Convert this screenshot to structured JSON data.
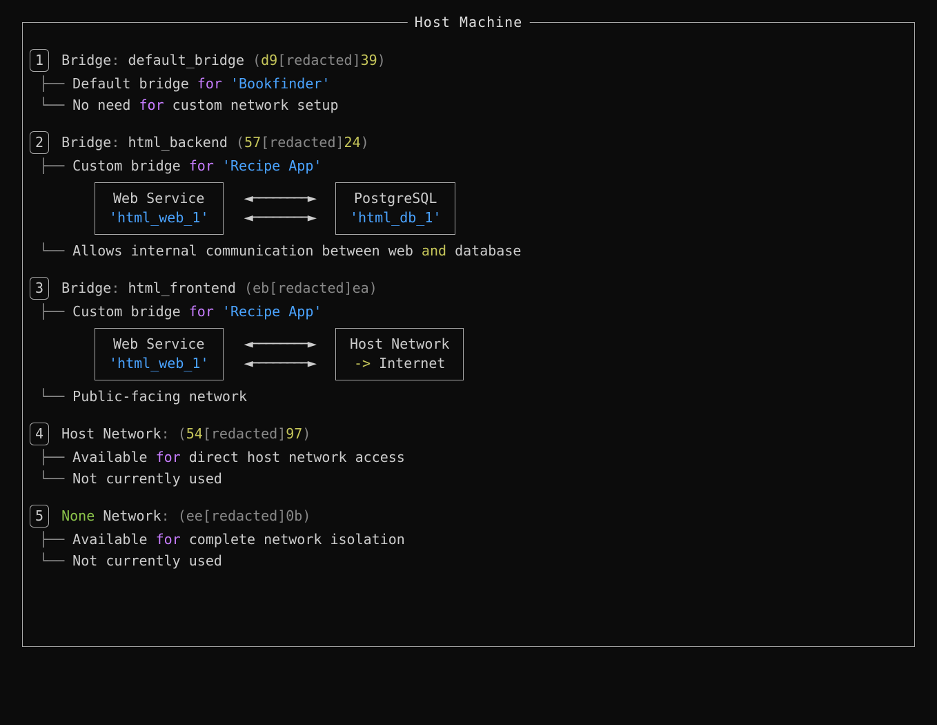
{
  "frame_title": "Host Machine",
  "entries": [
    {
      "num": "1",
      "head_pre": "Bridge",
      "head_name": "default_bridge",
      "id_a": "d9",
      "id_mid": "redacted",
      "id_b": "39",
      "bullets": [
        {
          "segs": [
            "Default bridge ",
            {
              "t": "for",
              "c": "magenta"
            },
            " ",
            {
              "t": "'Bookfinder'",
              "c": "blue"
            }
          ]
        },
        {
          "segs": [
            "No need ",
            {
              "t": "for",
              "c": "magenta"
            },
            " custom network setup"
          ]
        }
      ]
    },
    {
      "num": "2",
      "head_pre": "Bridge",
      "head_name": "html_backend",
      "id_a": "57",
      "id_mid": "redacted",
      "id_b": "24",
      "bullets_top": [
        {
          "segs": [
            "Custom bridge ",
            {
              "t": "for",
              "c": "magenta"
            },
            " ",
            {
              "t": "'Recipe App'",
              "c": "blue"
            }
          ]
        }
      ],
      "svc_left_title": "Web Service",
      "svc_left_name": "'html_web_1'",
      "svc_right_title": "PostgreSQL",
      "svc_right_name": "'html_db_1'",
      "bullets_bottom": [
        {
          "segs": [
            "Allows internal communication between web ",
            {
              "t": "and",
              "c": "yellow"
            },
            " database"
          ]
        }
      ]
    },
    {
      "num": "3",
      "head_pre": "Bridge",
      "head_name": "html_frontend",
      "id_a": "eb",
      "id_mid": "redacted",
      "id_b": "ea",
      "id_dim_all": true,
      "bullets_top": [
        {
          "segs": [
            "Custom bridge ",
            {
              "t": "for",
              "c": "magenta"
            },
            " ",
            {
              "t": "'Recipe App'",
              "c": "blue"
            }
          ]
        }
      ],
      "svc_left_title": "Web Service",
      "svc_left_name": "'html_web_1'",
      "svc_right_title": "Host Network",
      "svc_right_sub": "-> Internet",
      "bullets_bottom": [
        {
          "segs": [
            "Public-facing network"
          ]
        }
      ]
    },
    {
      "num": "4",
      "head_plain": "Host Network",
      "id_a": "54",
      "id_mid": "redacted",
      "id_b": "97",
      "bullets": [
        {
          "segs": [
            "Available ",
            {
              "t": "for",
              "c": "magenta"
            },
            " direct host network access"
          ]
        },
        {
          "segs": [
            "Not currently used"
          ]
        }
      ]
    },
    {
      "num": "5",
      "head_none": "None",
      "head_tail": "Network",
      "id_a": "ee",
      "id_mid": "redacted",
      "id_b": "0b",
      "id_dim_all": true,
      "bullets": [
        {
          "segs": [
            "Available ",
            {
              "t": "for",
              "c": "magenta"
            },
            " complete network isolation"
          ]
        },
        {
          "segs": [
            "Not currently used"
          ]
        }
      ]
    }
  ],
  "branch_mid": "├── ",
  "branch_end": "└── ",
  "arrow_r": "◄────────►",
  "arrow_r2": "◄────────►"
}
